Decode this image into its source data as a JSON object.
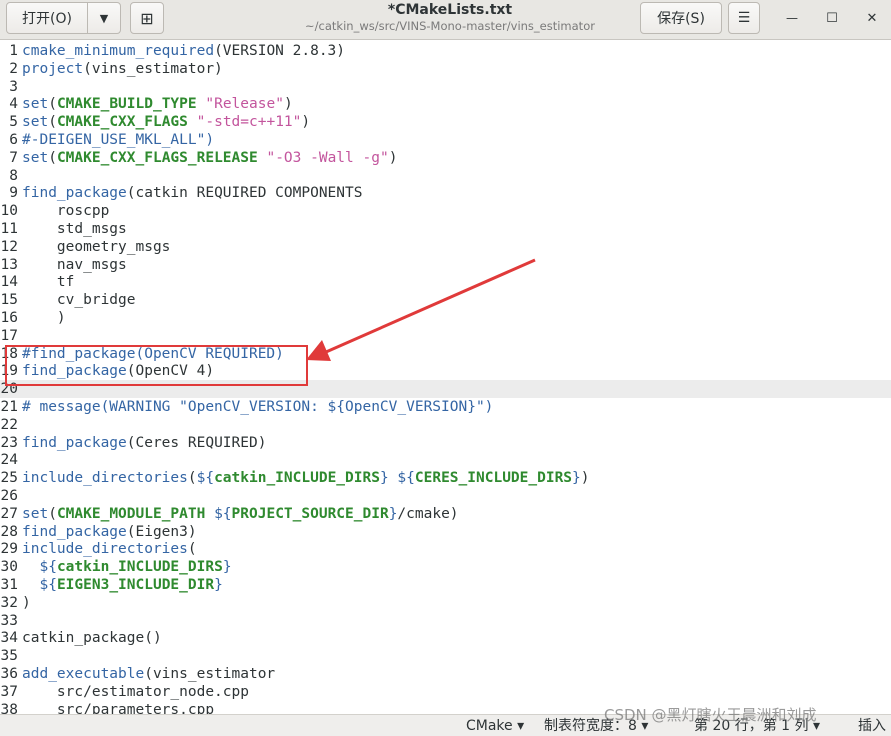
{
  "header": {
    "open_label": "打开(O)",
    "open_menu_icon": "▼",
    "new_tab_icon": "⊞",
    "title": "*CMakeLists.txt",
    "path": "~/catkin_ws/src/VINS-Mono-master/vins_estimator",
    "save_label": "保存(S)",
    "menu_icon": "☰",
    "minimize_icon": "—",
    "maximize_icon": "☐",
    "close_icon": "✕"
  },
  "colors": {
    "function": "#3465a4",
    "variable": "#2f8a2f",
    "string": "#c3559d",
    "annotation": "#e03a3a"
  },
  "editor": {
    "current_line": 20,
    "lines": [
      {
        "n": "1",
        "parts": [
          {
            "t": "cmake_minimum_required",
            "c": "func"
          },
          {
            "t": "(VERSION 2.8.3)",
            "c": "plain"
          }
        ]
      },
      {
        "n": "2",
        "parts": [
          {
            "t": "project",
            "c": "func"
          },
          {
            "t": "(vins_estimator)",
            "c": "plain"
          }
        ]
      },
      {
        "n": "3",
        "parts": []
      },
      {
        "n": "4",
        "parts": [
          {
            "t": "set",
            "c": "func"
          },
          {
            "t": "(",
            "c": "plain"
          },
          {
            "t": "CMAKE_BUILD_TYPE",
            "c": "var"
          },
          {
            "t": " ",
            "c": "plain"
          },
          {
            "t": "\"Release\"",
            "c": "str"
          },
          {
            "t": ")",
            "c": "plain"
          }
        ]
      },
      {
        "n": "5",
        "parts": [
          {
            "t": "set",
            "c": "func"
          },
          {
            "t": "(",
            "c": "plain"
          },
          {
            "t": "CMAKE_CXX_FLAGS",
            "c": "var"
          },
          {
            "t": " ",
            "c": "plain"
          },
          {
            "t": "\"-std=c++11\"",
            "c": "str"
          },
          {
            "t": ")",
            "c": "plain"
          }
        ]
      },
      {
        "n": "6",
        "parts": [
          {
            "t": "#-DEIGEN_USE_MKL_ALL\")",
            "c": "cmt"
          }
        ]
      },
      {
        "n": "7",
        "parts": [
          {
            "t": "set",
            "c": "func"
          },
          {
            "t": "(",
            "c": "plain"
          },
          {
            "t": "CMAKE_CXX_FLAGS_RELEASE",
            "c": "var"
          },
          {
            "t": " ",
            "c": "plain"
          },
          {
            "t": "\"-O3 -Wall -g\"",
            "c": "str"
          },
          {
            "t": ")",
            "c": "plain"
          }
        ]
      },
      {
        "n": "8",
        "parts": []
      },
      {
        "n": "9",
        "parts": [
          {
            "t": "find_package",
            "c": "func"
          },
          {
            "t": "(catkin REQUIRED COMPONENTS",
            "c": "plain"
          }
        ]
      },
      {
        "n": "10",
        "parts": [
          {
            "t": "    roscpp",
            "c": "plain"
          }
        ]
      },
      {
        "n": "11",
        "parts": [
          {
            "t": "    std_msgs",
            "c": "plain"
          }
        ]
      },
      {
        "n": "12",
        "parts": [
          {
            "t": "    geometry_msgs",
            "c": "plain"
          }
        ]
      },
      {
        "n": "13",
        "parts": [
          {
            "t": "    nav_msgs",
            "c": "plain"
          }
        ]
      },
      {
        "n": "14",
        "parts": [
          {
            "t": "    tf",
            "c": "plain"
          }
        ]
      },
      {
        "n": "15",
        "parts": [
          {
            "t": "    cv_bridge",
            "c": "plain"
          }
        ]
      },
      {
        "n": "16",
        "parts": [
          {
            "t": "    )",
            "c": "plain"
          }
        ]
      },
      {
        "n": "17",
        "parts": []
      },
      {
        "n": "18",
        "parts": [
          {
            "t": "#find_package(OpenCV REQUIRED)",
            "c": "cmt"
          }
        ]
      },
      {
        "n": "19",
        "parts": [
          {
            "t": "find_package",
            "c": "func"
          },
          {
            "t": "(OpenCV 4)",
            "c": "plain"
          }
        ]
      },
      {
        "n": "20",
        "parts": []
      },
      {
        "n": "21",
        "parts": [
          {
            "t": "# message(WARNING \"OpenCV_VERSION: ${OpenCV_VERSION}\")",
            "c": "cmt"
          }
        ]
      },
      {
        "n": "22",
        "parts": []
      },
      {
        "n": "23",
        "parts": [
          {
            "t": "find_package",
            "c": "func"
          },
          {
            "t": "(Ceres REQUIRED)",
            "c": "plain"
          }
        ]
      },
      {
        "n": "24",
        "parts": []
      },
      {
        "n": "25",
        "parts": [
          {
            "t": "include_directories",
            "c": "func"
          },
          {
            "t": "(",
            "c": "plain"
          },
          {
            "t": "${",
            "c": "func"
          },
          {
            "t": "catkin_INCLUDE_DIRS",
            "c": "var"
          },
          {
            "t": "}",
            "c": "func"
          },
          {
            "t": " ",
            "c": "plain"
          },
          {
            "t": "${",
            "c": "func"
          },
          {
            "t": "CERES_INCLUDE_DIRS",
            "c": "var"
          },
          {
            "t": "}",
            "c": "func"
          },
          {
            "t": ")",
            "c": "plain"
          }
        ]
      },
      {
        "n": "26",
        "parts": []
      },
      {
        "n": "27",
        "parts": [
          {
            "t": "set",
            "c": "func"
          },
          {
            "t": "(",
            "c": "plain"
          },
          {
            "t": "CMAKE_MODULE_PATH",
            "c": "var"
          },
          {
            "t": " ",
            "c": "plain"
          },
          {
            "t": "${",
            "c": "func"
          },
          {
            "t": "PROJECT_SOURCE_DIR",
            "c": "var"
          },
          {
            "t": "}",
            "c": "func"
          },
          {
            "t": "/cmake)",
            "c": "plain"
          }
        ]
      },
      {
        "n": "28",
        "parts": [
          {
            "t": "find_package",
            "c": "func"
          },
          {
            "t": "(Eigen3)",
            "c": "plain"
          }
        ]
      },
      {
        "n": "29",
        "parts": [
          {
            "t": "include_directories",
            "c": "func"
          },
          {
            "t": "(",
            "c": "plain"
          }
        ]
      },
      {
        "n": "30",
        "parts": [
          {
            "t": "  ",
            "c": "plain"
          },
          {
            "t": "${",
            "c": "func"
          },
          {
            "t": "catkin_INCLUDE_DIRS",
            "c": "var"
          },
          {
            "t": "}",
            "c": "func"
          }
        ]
      },
      {
        "n": "31",
        "parts": [
          {
            "t": "  ",
            "c": "plain"
          },
          {
            "t": "${",
            "c": "func"
          },
          {
            "t": "EIGEN3_INCLUDE_DIR",
            "c": "var"
          },
          {
            "t": "}",
            "c": "func"
          }
        ]
      },
      {
        "n": "32",
        "parts": [
          {
            "t": ")",
            "c": "plain"
          }
        ]
      },
      {
        "n": "33",
        "parts": []
      },
      {
        "n": "34",
        "parts": [
          {
            "t": "catkin_package()",
            "c": "plain"
          }
        ]
      },
      {
        "n": "35",
        "parts": []
      },
      {
        "n": "36",
        "parts": [
          {
            "t": "add_executable",
            "c": "func"
          },
          {
            "t": "(vins_estimator",
            "c": "plain"
          }
        ]
      },
      {
        "n": "37",
        "parts": [
          {
            "t": "    src/estimator_node.cpp",
            "c": "plain"
          }
        ]
      },
      {
        "n": "38",
        "parts": [
          {
            "t": "    src/parameters.cpp",
            "c": "plain"
          }
        ]
      }
    ]
  },
  "statusbar": {
    "language": "CMake ▾",
    "tab_width": "制表符宽度：8 ▾",
    "position": "第 20 行，第 1 列 ▾",
    "insert_mode": "插入"
  },
  "watermark": "CSDN @黑灯瞎火王晨洲和刘成"
}
